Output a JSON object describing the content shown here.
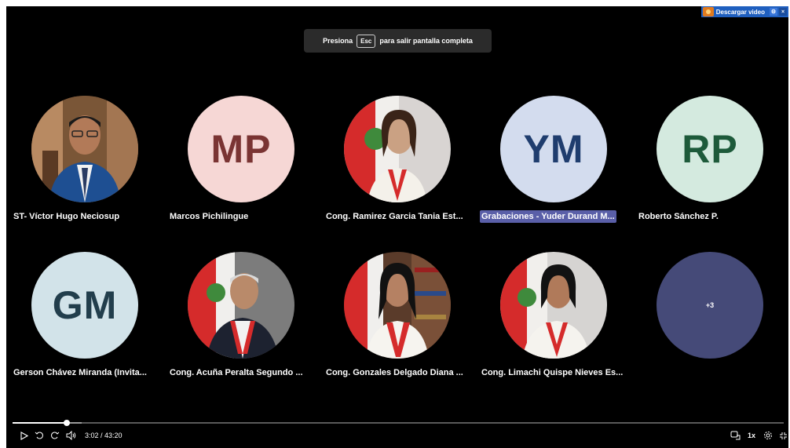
{
  "download_bar": {
    "label": "Descargar video"
  },
  "toast": {
    "prefix": "Presiona",
    "key": "Esc",
    "suffix": "para salir pantalla completa"
  },
  "participants": [
    {
      "name": "ST- Víctor Hugo Neciosup",
      "kind": "photo",
      "photo_theme": "man-blue-suit"
    },
    {
      "name": "Marcos Pichilingue",
      "kind": "initials",
      "initials": "MP",
      "bg": "#f6d7d5",
      "fg": "#7a3433"
    },
    {
      "name": "Cong. Ramirez Garcia Tania Est...",
      "kind": "photo",
      "photo_theme": "woman-flag-sash"
    },
    {
      "name": "Grabaciones - Yuder Durand M...",
      "kind": "initials",
      "initials": "YM",
      "bg": "#d3dcee",
      "fg": "#1f3d6e",
      "highlighted": true
    },
    {
      "name": "Roberto Sánchez P.",
      "kind": "initials",
      "initials": "RP",
      "bg": "#d4eadf",
      "fg": "#1d5a3a"
    },
    {
      "name": "Gerson Chávez Miranda (Invita...",
      "kind": "initials",
      "initials": "GM",
      "bg": "#d2e3e9",
      "fg": "#223e4c"
    },
    {
      "name": "Cong. Acuña Peralta Segundo ...",
      "kind": "photo",
      "photo_theme": "man-flag-sash"
    },
    {
      "name": "Cong. Gonzales Delgado Diana ...",
      "kind": "photo",
      "photo_theme": "woman-bookshelf-sash"
    },
    {
      "name": "Cong. Limachi Quispe Nieves Es...",
      "kind": "photo",
      "photo_theme": "woman-flag-sash-2"
    },
    {
      "name": "",
      "kind": "overflow",
      "initials": "+3",
      "bg": "#454a78",
      "fg": "#ffffff"
    }
  ],
  "player": {
    "current_time": "3:02",
    "duration": "43:20",
    "time_display": "3:02 / 43:20",
    "progress_fraction": 0.07,
    "buffered_fraction": 0.09,
    "speed": "1x",
    "icons": [
      "play-icon",
      "skip-back-icon",
      "skip-forward-icon",
      "volume-icon",
      "captions-icon",
      "settings-icon",
      "exit-fullscreen-icon"
    ]
  }
}
